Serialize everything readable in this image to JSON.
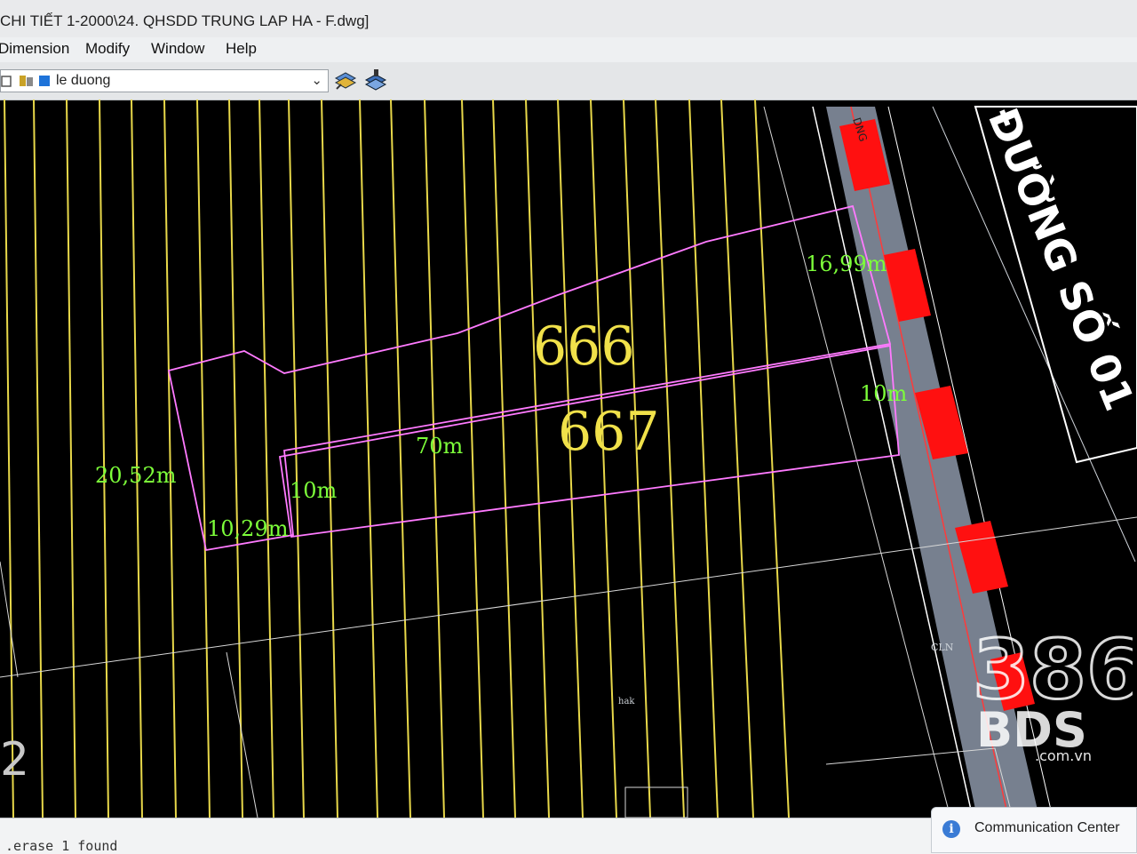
{
  "window": {
    "title": "CHI TIẾT 1-2000\\24. QHSDD TRUNG LAP HA - F.dwg]"
  },
  "menu": {
    "items": [
      "Dimension",
      "Modify",
      "Window",
      "Help"
    ]
  },
  "toolbar": {
    "layer_name": "le duong",
    "icons": [
      "layer-state-icon",
      "layer-properties-icon",
      "layer-color-icon",
      "layer-manager-icon",
      "layer-previous-icon"
    ]
  },
  "drawing": {
    "parcel_666": "666",
    "parcel_667": "667",
    "road_label": "ĐƯỜNG SỐ 01",
    "dimensions": {
      "d_1699": "16,99m",
      "d_10_right": "10m",
      "d_70": "70m",
      "d_2052": "20,52m",
      "d_10_left": "10m",
      "d_1029": "10,29m"
    },
    "small_labels": {
      "cln": "CLN",
      "hak": "hak",
      "edge_number": "2",
      "road_tag": "DNG"
    },
    "colors": {
      "background": "#000000",
      "grid_lines": "#e8d84a",
      "parcel_outline": "#ff7aff",
      "parcel_number": "#f0e14a",
      "dimension_text": "#7dff3a",
      "road_fill": "#8c97a8",
      "road_marker": "#ff1a1a",
      "road_text": "#ffffff"
    }
  },
  "command_line": {
    "text": ".erase 1 found"
  },
  "notification": {
    "label": "Communication Center"
  },
  "watermark": {
    "number": "386",
    "brand": "BDS",
    "domain": ".com.vn"
  }
}
